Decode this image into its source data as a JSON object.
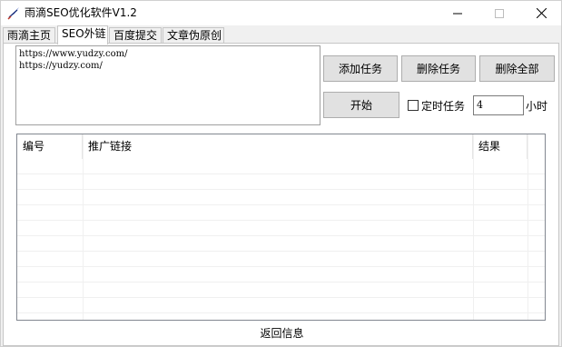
{
  "window": {
    "title": "雨滴SEO优化软件V1.2",
    "minimize_glyph": "—",
    "maximize_glyph": "☐",
    "close_glyph": "✕",
    "icon": "feather-icon"
  },
  "tabs": [
    {
      "label": "雨滴主页",
      "active": false
    },
    {
      "label": "SEO外链",
      "active": true
    },
    {
      "label": "百度提交",
      "active": false
    },
    {
      "label": "文章伪原创",
      "active": false
    }
  ],
  "urls_text": "https://www.yudzy.com/\nhttps://yudzy.com/",
  "buttons": {
    "add_task": "添加任务",
    "delete_task": "删除任务",
    "delete_all": "删除全部",
    "start": "开始"
  },
  "timer": {
    "checkbox_label": "定时任务",
    "checked": false,
    "hours_value": "4",
    "unit_label": "小时"
  },
  "list": {
    "columns": [
      "编号",
      "推广链接",
      "结果"
    ],
    "rows": []
  },
  "status_text": "返回信息"
}
